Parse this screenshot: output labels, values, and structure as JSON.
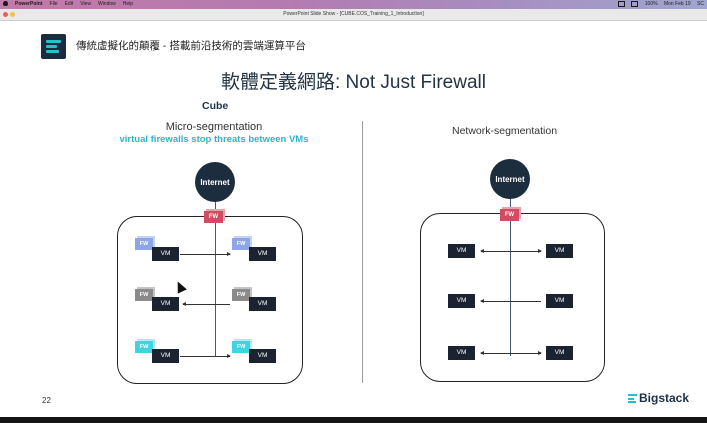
{
  "menubar": {
    "app": "PowerPoint",
    "items": [
      "File",
      "Edit",
      "View",
      "Window",
      "Help"
    ],
    "status": [
      "100%",
      "Mon Feb 19",
      "SC"
    ]
  },
  "window": {
    "title": "PowerPoint Slide Show - [CUBE.COS_Training_1_Introduction]"
  },
  "slide": {
    "header": "傳統虛擬化的顛覆 - 搭載前沿技術的雲端運算平台",
    "title": "軟體定義網路: Not Just Firewall",
    "left": {
      "brand_label": "Cube",
      "heading": "Micro-segmentation",
      "subheading": "virtual firewalls stop threats between VMs",
      "internet_label": "Internet",
      "fw_label": "FW",
      "vm_label": "VM"
    },
    "right": {
      "heading": "Network-segmentation",
      "internet_label": "Internet",
      "fw_label": "FW",
      "vm_label": "VM"
    },
    "page_number": "22",
    "brand": "Bigstack"
  },
  "colors": {
    "navy": "#1c2d3e",
    "fw_red": "#d04c62",
    "accent_cyan": "#2bb5cf",
    "fw_blue": "#8ea5e6",
    "fw_gray": "#8a8a8a",
    "fw_cyan": "#3fd5e0"
  }
}
